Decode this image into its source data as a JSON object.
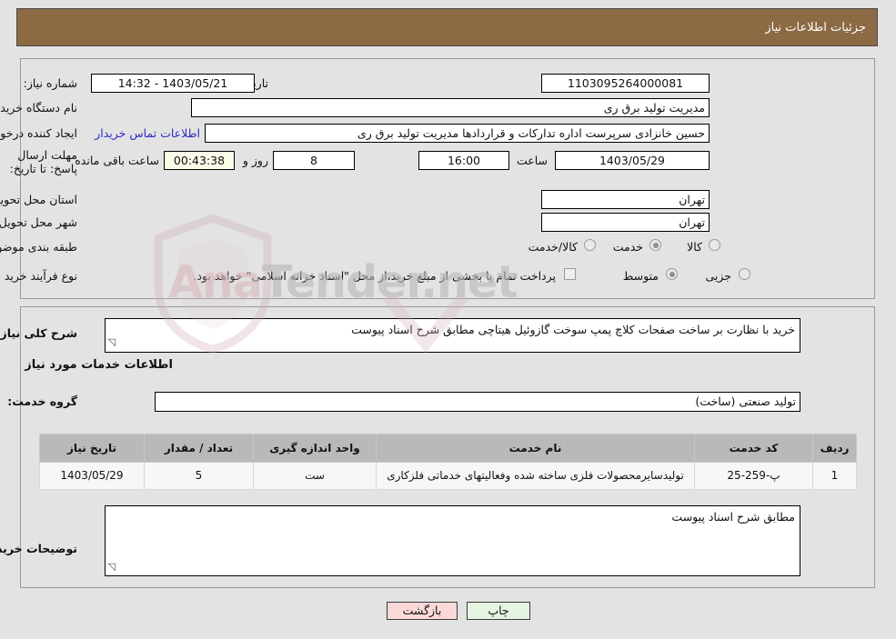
{
  "header": {
    "title": "جزئیات اطلاعات نیاز"
  },
  "top_form": {
    "need_number_label": "شماره نیاز:",
    "need_number_value": "1103095264000081",
    "announce_datetime_label": "تاریخ و ساعت اعلان عمومی:",
    "announce_datetime_value": "1403/05/21 - 14:32",
    "buyer_org_label": "نام دستگاه خریدار:",
    "buyer_org_value": "مدیریت تولید برق ری",
    "creator_label": "ایجاد کننده درخواست:",
    "creator_value": "حسین خانزادی سرپرست اداره تدارکات و قراردادها مدیریت تولید برق ری",
    "contact_link": "اطلاعات تماس خریدار",
    "deadline_label": "مهلت ارسال پاسخ: تا تاریخ:",
    "deadline_date": "1403/05/29",
    "deadline_hour_label": "ساعت",
    "deadline_hour_value": "16:00",
    "remaining_days": "8",
    "remaining_days_label": "روز و",
    "remaining_time": "00:43:38",
    "remaining_time_label": "ساعت باقی مانده",
    "province_label": "استان محل تحویل:",
    "province_value": "تهران",
    "city_label": "شهر محل تحویل:",
    "city_value": "تهران",
    "category_label": "طبقه بندی موضوعی:",
    "category_options": [
      {
        "label": "کالا",
        "selected": false
      },
      {
        "label": "خدمت",
        "selected": true
      },
      {
        "label": "کالا/خدمت",
        "selected": false
      }
    ],
    "process_label": "نوع فرآیند خرید :",
    "process_options": [
      {
        "label": "جزیی",
        "selected": false
      },
      {
        "label": "متوسط",
        "selected": true
      }
    ],
    "treasury_checkbox_checked": false,
    "treasury_note": "پرداخت تمام یا بخشی از مبلغ خرید،از محل \"اسناد خزانه اسلامی\" خواهد بود."
  },
  "bottom_form": {
    "general_desc_label": "شرح کلی نیاز:",
    "general_desc_value": "خرید با نظارت بر ساخت صفحات کلاچ پمپ سوخت گازوئیل هیتاچی مطابق شرح اسناد پیوست",
    "services_section_title": "اطلاعات خدمات مورد نیاز",
    "service_group_label": "گروه خدمت:",
    "service_group_value": "تولید صنعتی (ساخت)",
    "buyer_notes_label": "توضیحات خریدار:",
    "buyer_notes_value": "مطابق شرح اسناد پیوست"
  },
  "table": {
    "columns": [
      "ردیف",
      "کد خدمت",
      "نام خدمت",
      "واحد اندازه گیری",
      "تعداد / مقدار",
      "تاریخ نیاز"
    ],
    "rows": [
      {
        "row_no": "1",
        "service_code": "پ-259-25",
        "service_name": "تولیدسایرمحصولات فلزی ساخته شده وفعالیتهای خدماتی فلزکاری",
        "unit": "ست",
        "quantity": "5",
        "need_date": "1403/05/29"
      }
    ]
  },
  "footer": {
    "print_label": "چاپ",
    "back_label": "بازگشت"
  },
  "watermark": {
    "text_left": "Ana",
    "text_right": "Tender.net"
  },
  "colors": {
    "banner": "#8b6a44",
    "page_bg": "#e3e3e3",
    "link": "#2b2bc8",
    "table_header": "#b9b9b9",
    "print_btn": "#e6f5e2",
    "back_btn": "#fbd9d9",
    "countdown_bg": "#fbfbe8"
  }
}
